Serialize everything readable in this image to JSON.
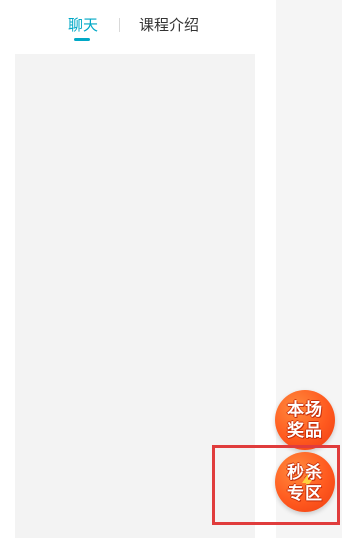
{
  "tabs": {
    "chat": "聊天",
    "course_intro": "课程介绍",
    "active": "chat"
  },
  "badges": {
    "prize": {
      "line1": "本场",
      "line2": "奖品"
    },
    "flash_sale": {
      "line1": "秒杀",
      "line2": "专区"
    }
  },
  "colors": {
    "accent": "#00a8c6",
    "badge": "#ff5a1f",
    "highlight": "#e03c3c"
  }
}
